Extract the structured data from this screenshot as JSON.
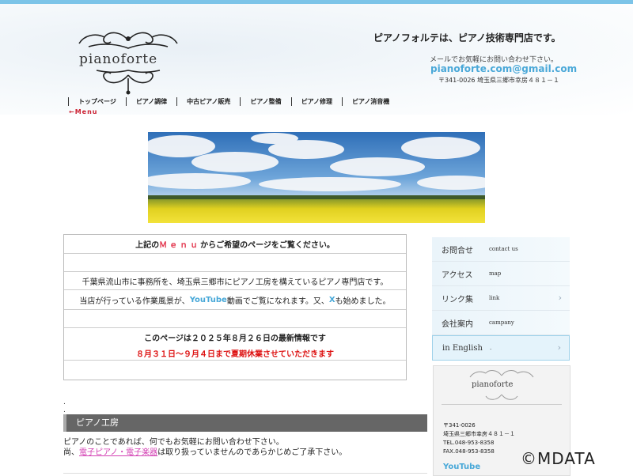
{
  "header": {
    "logo_text": "pianoforte",
    "tagline": "ピアノフォルテは、ピアノ技術専門店です。",
    "mail_note": "メールでお気軽にお問い合わせ下さい。",
    "email": "pianoforte.com@gmail.com",
    "address": "〒341-0026 埼玉県三郷市幸房４８１－１"
  },
  "nav": {
    "items": [
      "トップページ",
      "ピアノ調律",
      "中古ピアノ販売",
      "ピアノ整備",
      "ピアノ修理",
      "ピアノ消音機"
    ],
    "menu_arrow": "←Menu"
  },
  "notice": {
    "line1_prefix": "上記の",
    "line1_menu": "Ｍｅｎｕ",
    "line1_suffix": "からご希望のページをご覧ください。",
    "line2": "千葉県流山市に事務所を、埼玉県三郷市にピアノ工房を構えているピアノ専門店です。",
    "line3_prefix": "当店が行っている作業風景が、",
    "line3_yt": "YouTube",
    "line3_mid": "動画でご覧になれます。又、",
    "line3_x": "X",
    "line3_suffix": "も始めました。",
    "latest": "このページは２０２５年８月２６日の最新情報です",
    "holiday": "８月３１日～９月４日まで夏期休業させていただきます"
  },
  "section": {
    "title": "ピアノ工房",
    "text1": "ピアノのことであれば、何でもお気軽にお問い合わせ下さい。",
    "text2_prefix": "尚、",
    "text2_link": "電子ピアノ・電子楽器",
    "text2_suffix": "は取り扱っていませんのであらかじめご了承下さい。"
  },
  "side_menu": [
    {
      "ja": "お問合せ",
      "en": "contact us"
    },
    {
      "ja": "アクセス",
      "en": "map"
    },
    {
      "ja": "リンク集",
      "en": "link"
    },
    {
      "ja": "会社案内",
      "en": "campany"
    },
    {
      "ja": "in English",
      "en": "."
    }
  ],
  "card": {
    "logo": "pianoforte",
    "zip": "〒341-0026",
    "address": "埼玉県三郷市幸房４８１－１",
    "tel": "TEL.048-953-8358",
    "fax": "FAX.048-953-8358",
    "youtube": "YouTube"
  },
  "watermark": "©MDATA",
  "colors": {
    "accent": "#4aa8d8",
    "alert": "#dd1111",
    "menu_red": "#e2324a",
    "link_pink": "#d33fb3"
  }
}
